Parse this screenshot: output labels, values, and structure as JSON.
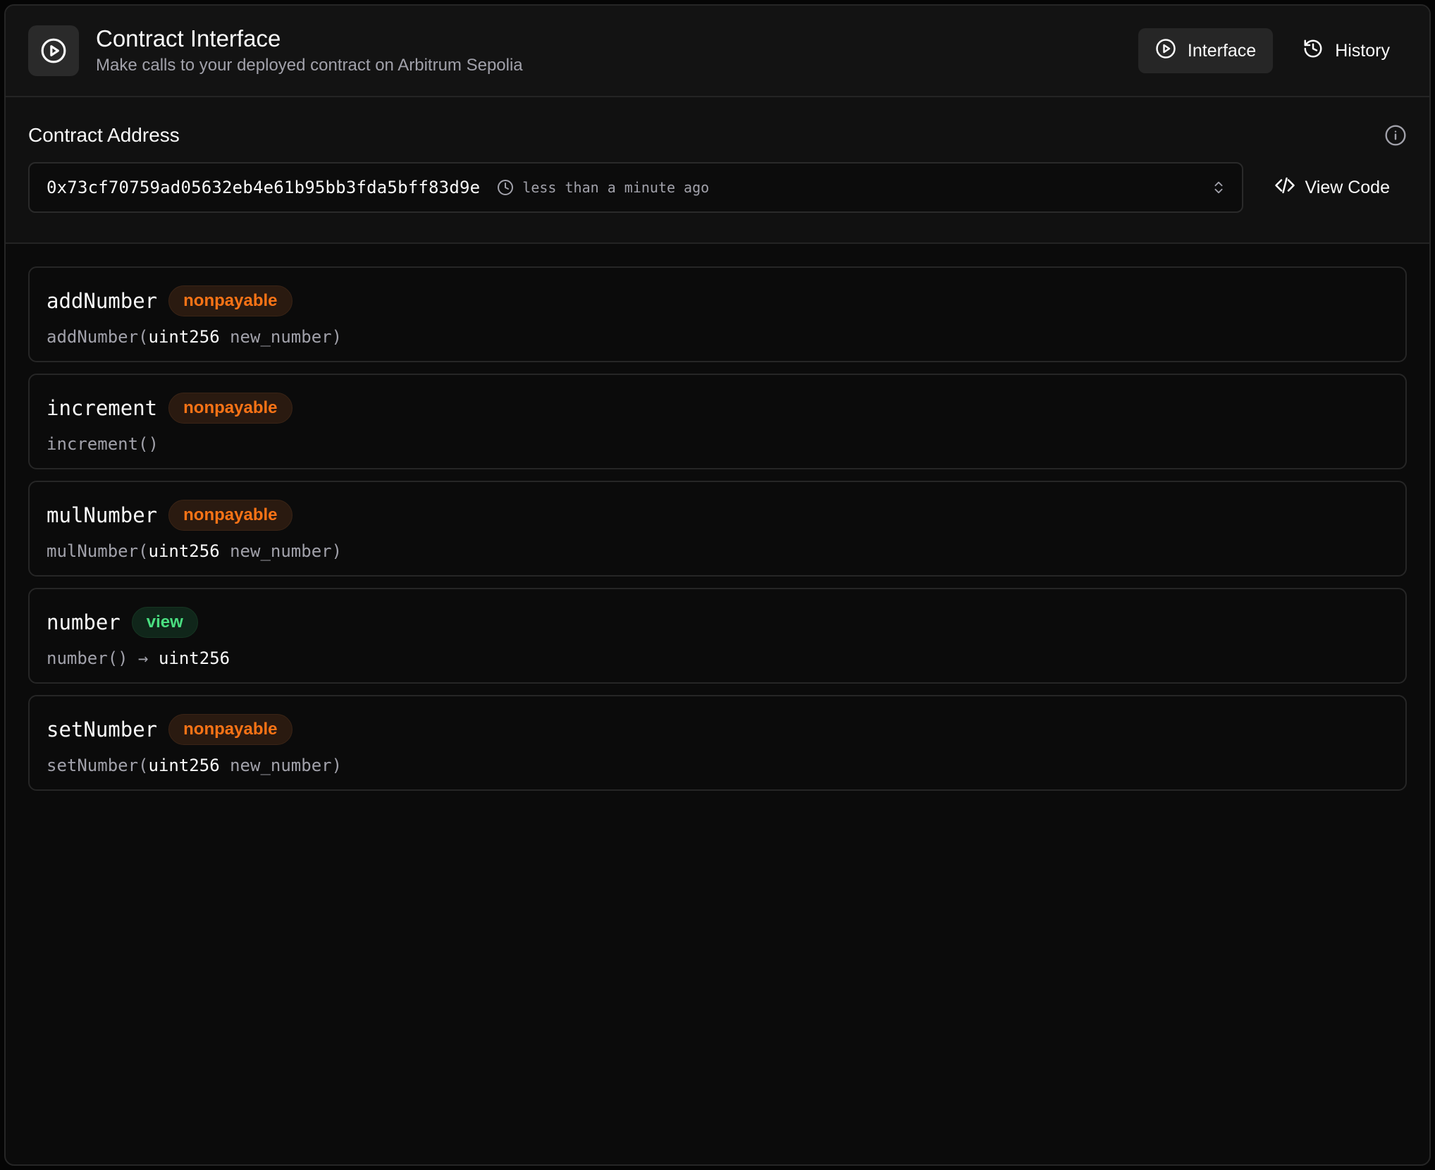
{
  "header": {
    "title": "Contract Interface",
    "subtitle": "Make calls to your deployed contract on Arbitrum Sepolia",
    "icon": "play-circle-icon",
    "tabs": [
      {
        "label": "Interface",
        "icon": "play-circle-icon",
        "active": true
      },
      {
        "label": "History",
        "icon": "history-icon",
        "active": false
      }
    ]
  },
  "address": {
    "label": "Contract Address",
    "value": "0x73cf70759ad05632eb4e61b95bb3fda5bff83d9e",
    "timestamp": "less than a minute ago",
    "view_code_label": "View Code"
  },
  "functions": [
    {
      "name": "addNumber",
      "badge": "nonpayable",
      "sig_prefix": "addNumber(",
      "sig_type": "uint256",
      "sig_rest": " new_number)"
    },
    {
      "name": "increment",
      "badge": "nonpayable",
      "sig_prefix": "increment()",
      "sig_type": "",
      "sig_rest": ""
    },
    {
      "name": "mulNumber",
      "badge": "nonpayable",
      "sig_prefix": "mulNumber(",
      "sig_type": "uint256",
      "sig_rest": " new_number)"
    },
    {
      "name": "number",
      "badge": "view",
      "sig_prefix": "number() → ",
      "sig_type": "uint256",
      "sig_rest": ""
    },
    {
      "name": "setNumber",
      "badge": "nonpayable",
      "sig_prefix": "setNumber(",
      "sig_type": "uint256",
      "sig_rest": " new_number)"
    }
  ],
  "colors": {
    "nonpayable": "#f97316",
    "view": "#4ade80",
    "background": "#0b0b0b"
  }
}
